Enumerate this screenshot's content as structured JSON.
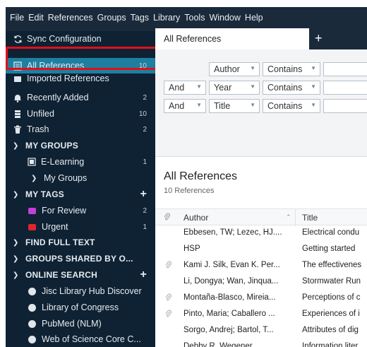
{
  "menubar": [
    "File",
    "Edit",
    "References",
    "Groups",
    "Tags",
    "Library",
    "Tools",
    "Window",
    "Help"
  ],
  "sidebar": {
    "sync": "Sync Configuration",
    "all_references": {
      "label": "All References",
      "count": "10"
    },
    "imported": "Imported References",
    "recently_added": {
      "label": "Recently Added",
      "count": "2"
    },
    "unfiled": {
      "label": "Unfiled",
      "count": "10"
    },
    "trash": {
      "label": "Trash",
      "count": "2"
    },
    "my_groups": {
      "label": "MY GROUPS"
    },
    "elearning": {
      "label": "E-Learning",
      "count": "1"
    },
    "my_groups_sub": "My Groups",
    "my_tags": {
      "label": "MY TAGS"
    },
    "for_review": {
      "label": "For Review",
      "count": "2",
      "color": "#c33fd6"
    },
    "urgent": {
      "label": "Urgent",
      "count": "1",
      "color": "#e0242e"
    },
    "find_full_text": "FIND FULL TEXT",
    "groups_shared": "GROUPS SHARED BY O...",
    "online_search": "ONLINE SEARCH",
    "online": [
      "Jisc Library Hub Discover",
      "Library of Congress",
      "PubMed (NLM)",
      "Web of Science Core C..."
    ]
  },
  "tabs": {
    "active": "All References",
    "add": "+"
  },
  "search": {
    "rows": [
      {
        "bool": "",
        "field": "Author",
        "op": "Contains"
      },
      {
        "bool": "And",
        "field": "Year",
        "op": "Contains"
      },
      {
        "bool": "And",
        "field": "Title",
        "op": "Contains"
      }
    ]
  },
  "list": {
    "title": "All References",
    "subtitle": "10 References",
    "col_author": "Author",
    "col_title": "Title"
  },
  "references": [
    {
      "attach": false,
      "author": "Ebbesen, TW; Lezec, HJ....",
      "title": "Electrical condu"
    },
    {
      "attach": false,
      "author": "HSP",
      "title": "Getting started"
    },
    {
      "attach": true,
      "author": "Kami J. Silk, Evan K. Per...",
      "title": "The effectivenes"
    },
    {
      "attach": false,
      "author": "Li, Dongya; Wan, Jinqua...",
      "title": "Stormwater Run"
    },
    {
      "attach": true,
      "author": "Montaña-Blasco, Mireia...",
      "title": "Perceptions of c"
    },
    {
      "attach": true,
      "author": "Pinto, Maria; Caballero ...",
      "title": "Experiences of i"
    },
    {
      "attach": false,
      "author": "Šorgo, Andrej; Bartol, T...",
      "title": "Attributes of dig"
    },
    {
      "attach": false,
      "author": "Debby R. Wegener",
      "title": "Information liter"
    }
  ]
}
